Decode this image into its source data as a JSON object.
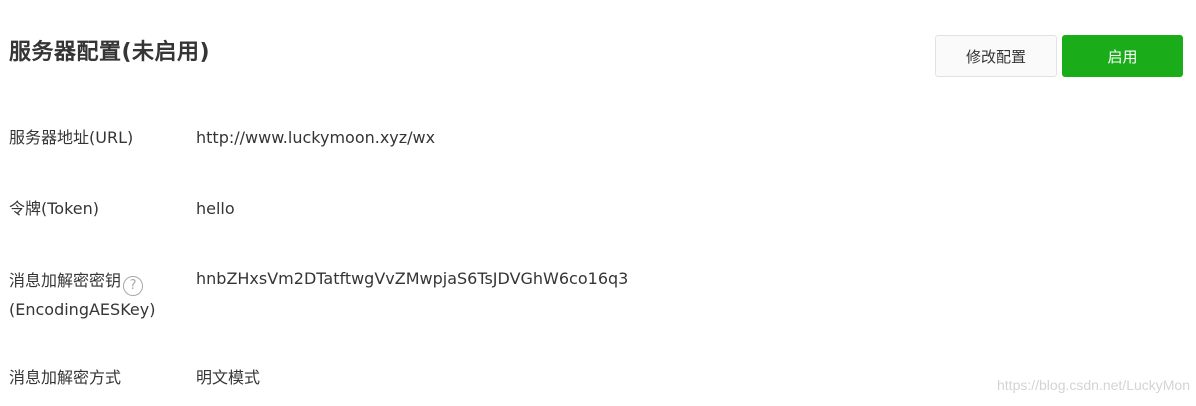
{
  "header": {
    "title": "服务器配置(未启用)",
    "edit_button_label": "修改配置",
    "enable_button_label": "启用"
  },
  "config": {
    "url": {
      "label": "服务器地址(URL)",
      "value": "http://www.luckymoon.xyz/wx"
    },
    "token": {
      "label": "令牌(Token)",
      "value": "hello"
    },
    "aes_key": {
      "label_line1": "消息加解密密钥",
      "label_line2": "(EncodingAESKey)",
      "help_glyph": "?",
      "value": "hnbZHxsVm2DTatftwgVvZMwpjaS6TsJDVGhW6co16q3"
    },
    "encryption_mode": {
      "label": "消息加解密方式",
      "value": "明文模式"
    }
  },
  "watermark": "https://blog.csdn.net/LuckyMon",
  "colors": {
    "primary_green": "#1aad19",
    "text": "#353535",
    "secondary_button_bg": "#fafafa"
  },
  "icons": {
    "help": "question-circle-icon"
  }
}
